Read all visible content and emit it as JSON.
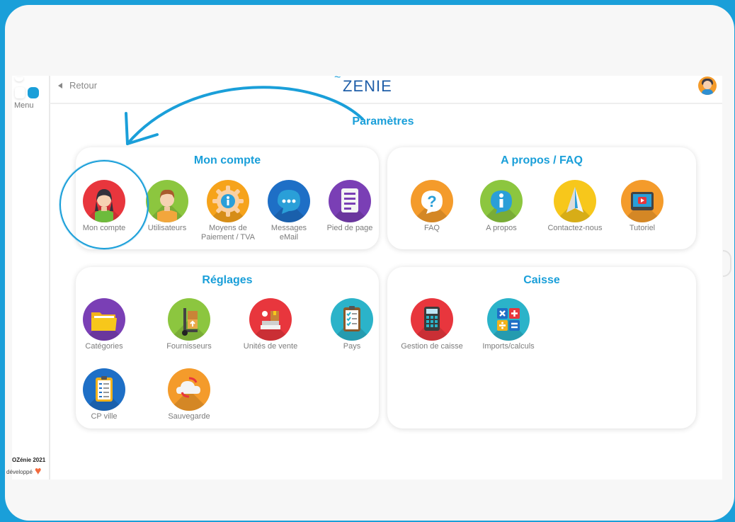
{
  "app": {
    "logo": "ZENIE",
    "logo_mark": "~",
    "page_title": "Paramètres"
  },
  "sidebar": {
    "menu_label": "Menu",
    "footer_brand": "OZénie 2021",
    "footer_made": "développé"
  },
  "topbar": {
    "back_label": "Retour"
  },
  "cards": {
    "mon_compte": {
      "title": "Mon compte",
      "items": [
        {
          "label": "Mon compte",
          "icon": "user-woman-icon",
          "color": "#e8363d"
        },
        {
          "label": "Utilisateurs",
          "icon": "user-man-icon",
          "color": "#8cc63f"
        },
        {
          "label": "Moyens de\nPaiement  / TVA",
          "icon": "gear-info-icon",
          "color": "#f6a31b"
        },
        {
          "label": "Messages\neMail",
          "icon": "chat-bubble-icon",
          "color": "#1e6fc6"
        },
        {
          "label": "Pied de page",
          "icon": "document-icon",
          "color": "#7a3fb5"
        }
      ]
    },
    "apropos": {
      "title": "A propos / FAQ",
      "items": [
        {
          "label": "FAQ",
          "icon": "question-icon",
          "color": "#f49b2b"
        },
        {
          "label": "A propos",
          "icon": "info-icon",
          "color": "#8cc63f"
        },
        {
          "label": "Contactez-nous",
          "icon": "paper-plane-icon",
          "color": "#f7c71b"
        },
        {
          "label": "Tutoriel",
          "icon": "video-icon",
          "color": "#f49b2b"
        }
      ]
    },
    "reglages": {
      "title": "Réglages",
      "items": [
        {
          "label": "Catégories",
          "icon": "folder-icon",
          "color": "#7a3fb5"
        },
        {
          "label": "Fournisseurs",
          "icon": "hand-truck-icon",
          "color": "#8cc63f"
        },
        {
          "label": "Unités de vente",
          "icon": "scale-icon",
          "color": "#e8363d"
        },
        {
          "label": "Pays",
          "icon": "clipboard-icon",
          "color": "#2bb3c9"
        },
        {
          "label": "CP ville",
          "icon": "clipboard-list-icon",
          "color": "#1e6fc6"
        },
        {
          "label": "Sauvegarde",
          "icon": "cloud-sync-icon",
          "color": "#f49b2b"
        }
      ]
    },
    "caisse": {
      "title": "Caisse",
      "items": [
        {
          "label": "Gestion de caisse",
          "icon": "calculator-icon",
          "color": "#e8363d"
        },
        {
          "label": "Imports/calculs",
          "icon": "math-operators-icon",
          "color": "#2bb3c9"
        }
      ]
    }
  },
  "colors": {
    "accent": "#1a9fd9",
    "background": "#1a9fd9"
  }
}
